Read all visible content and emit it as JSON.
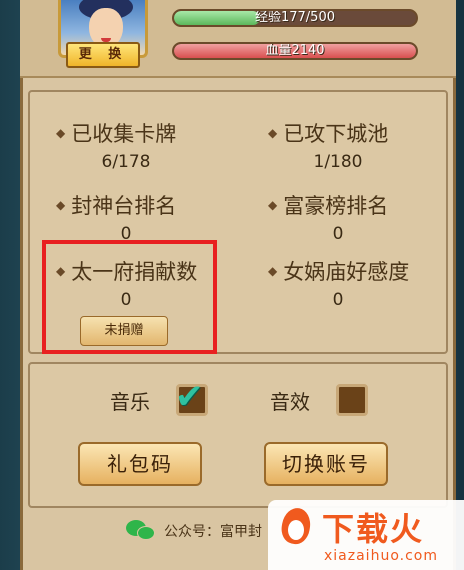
{
  "header": {
    "swap_label": "更 换",
    "exp_text": "经验177/500",
    "exp_ratio": 0.354,
    "hp_text": "血量2140"
  },
  "stats": [
    {
      "label": "已收集卡牌",
      "value": "6/178"
    },
    {
      "label": "已攻下城池",
      "value": "1/180"
    },
    {
      "label": "封神台排名",
      "value": "0"
    },
    {
      "label": "富豪榜排名",
      "value": "0"
    },
    {
      "label": "太一府捐献数",
      "value": "0"
    },
    {
      "label": "女娲庙好感度",
      "value": "0"
    }
  ],
  "donate_label": "未捐赠",
  "settings": {
    "music_label": "音乐",
    "music_checked": true,
    "sfx_label": "音效",
    "sfx_checked": false
  },
  "buttons": {
    "gift_code": "礼包码",
    "switch_account": "切换账号"
  },
  "footer": {
    "text": "公众号：富甲封"
  },
  "watermark": {
    "title": "下载火",
    "subtitle": "xiazaihuo.com"
  },
  "colors": {
    "panel_bg": "#dcc8a4",
    "highlight": "#e82020",
    "check": "#2fc1a0",
    "watermark": "#f05a1e"
  }
}
